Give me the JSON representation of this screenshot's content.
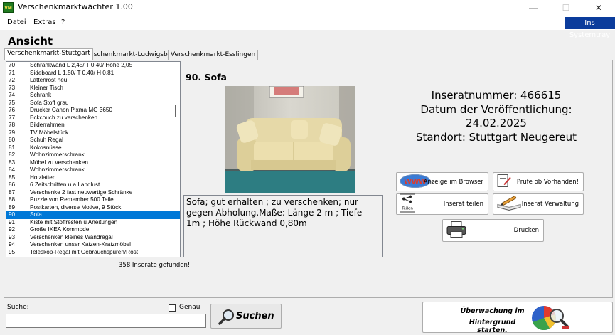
{
  "window": {
    "title": "Verschenkmarktwächter 1.00",
    "icon_text": "VM",
    "minimize": "—",
    "maximize": "☐",
    "close": "✕"
  },
  "menu": {
    "items": [
      "Datei",
      "Extras",
      "?"
    ],
    "tray_button": "Ins Systemtray"
  },
  "section_title": "Ansicht",
  "tabs": [
    "Verschenkmarkt-Stuttgart",
    "Verschenkmarkt-Ludwigsburg",
    "Verschenkmarkt-Esslingen"
  ],
  "list": {
    "rows": [
      {
        "num": "70",
        "text": "Schrankwand  L 2,45/ T 0,40/ Höhe 2,05"
      },
      {
        "num": "71",
        "text": "Sideboard L 1,50/ T 0,40/ H 0,81"
      },
      {
        "num": "72",
        "text": "Lattenrost neu"
      },
      {
        "num": "73",
        "text": "Kleiner Tisch"
      },
      {
        "num": "74",
        "text": "Schrank"
      },
      {
        "num": "75",
        "text": "Sofa  Stoff grau"
      },
      {
        "num": "76",
        "text": "Drucker Canon Pixma MG 3650"
      },
      {
        "num": "77",
        "text": "Eckcouch zu verschenken"
      },
      {
        "num": "78",
        "text": "Bilderrahmen"
      },
      {
        "num": "79",
        "text": "TV Möbelstück"
      },
      {
        "num": "80",
        "text": "Schuh Regal"
      },
      {
        "num": "81",
        "text": "Kokosnüsse"
      },
      {
        "num": "82",
        "text": "Wohnzimmerschrank"
      },
      {
        "num": "83",
        "text": "Möbel  zu verschenken"
      },
      {
        "num": "84",
        "text": "Wohnzimmerschrank"
      },
      {
        "num": "85",
        "text": "Holzlatten"
      },
      {
        "num": "86",
        "text": "6 Zeitschriften u.a Landlust"
      },
      {
        "num": "87",
        "text": "Verschenke 2 fast neuwertige Schränke"
      },
      {
        "num": "88",
        "text": "Puzzle von Remember 500 Teile"
      },
      {
        "num": "89",
        "text": "Postkarten, diverse Motive, 9 Stück"
      },
      {
        "num": "90",
        "text": "Sofa"
      },
      {
        "num": "91",
        "text": "Kiste mit Stoffresten u Aneitungen"
      },
      {
        "num": "92",
        "text": "Große IKEA Kommode"
      },
      {
        "num": "93",
        "text": "Verschenken kleines Wandregal"
      },
      {
        "num": "94",
        "text": "Verschenken unser Katzen-Kratzmöbel"
      },
      {
        "num": "95",
        "text": "Teleskop-Regal mit Gebrauchspuren/Rost"
      }
    ],
    "selected_index": 20,
    "found_text": "358 Inserate gefunden!"
  },
  "detail": {
    "title": "90. Sofa",
    "inserat_line": "Inseratnummer: 466615",
    "datum_label": "Datum der Veröffentlichung:",
    "datum_value": "24.02.2025",
    "standort_line": "Standort: Stuttgart Neugereut",
    "description": "Sofa; gut erhalten ; zu verschenken; nur gegen Abholung.Maße: Länge 2 m ; Tiefe 1m ; Höhe Rückwand 0,80m"
  },
  "buttons": {
    "browser": "Anzeige im Browser",
    "check": "Prüfe ob Vorhanden!",
    "share": "Inserat teilen",
    "share_icon_text": "Teilen",
    "manage": "Inserat Verwaltung",
    "print": "Drucken",
    "www_icon_text": "WWW"
  },
  "search": {
    "label": "Suche:",
    "value": "",
    "genau_label": "Genau",
    "genau_checked": false,
    "button_label": "Suchen"
  },
  "monitor": {
    "line1": "Überwachung im",
    "line2": "Hintergrund starten."
  },
  "colors": {
    "selection": "#0078d7",
    "tray_button": "#0b3c9c",
    "app_icon": "#1f7a1f"
  }
}
